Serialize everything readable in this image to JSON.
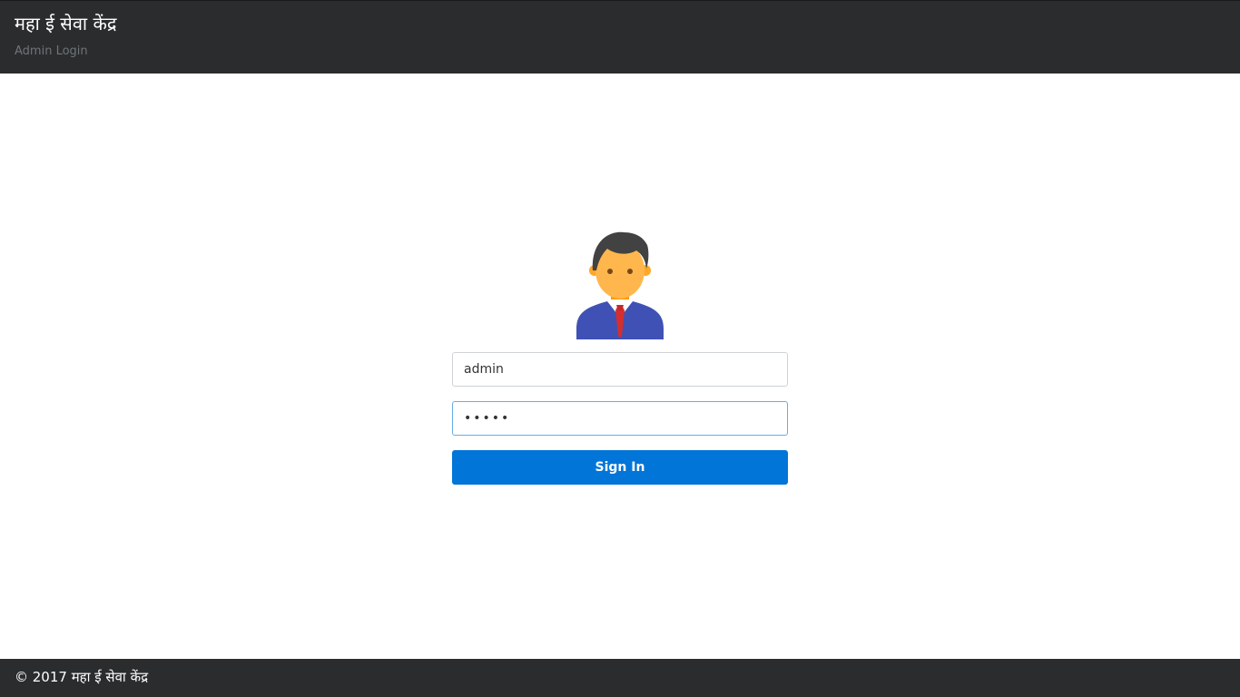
{
  "header": {
    "title": "महा ई सेवा केंद्र",
    "subtitle": "Admin Login"
  },
  "avatar": {
    "icon": "user-avatar-icon"
  },
  "login_form": {
    "username_value": "admin",
    "password_value": "•••••",
    "signin_label": "Sign In"
  },
  "footer": {
    "text": "© 2017 महा ई सेवा केंद्र"
  },
  "colors": {
    "header_bg": "#2b2c2e",
    "primary_button": "#0275d8",
    "focus_border": "#66aee6"
  }
}
